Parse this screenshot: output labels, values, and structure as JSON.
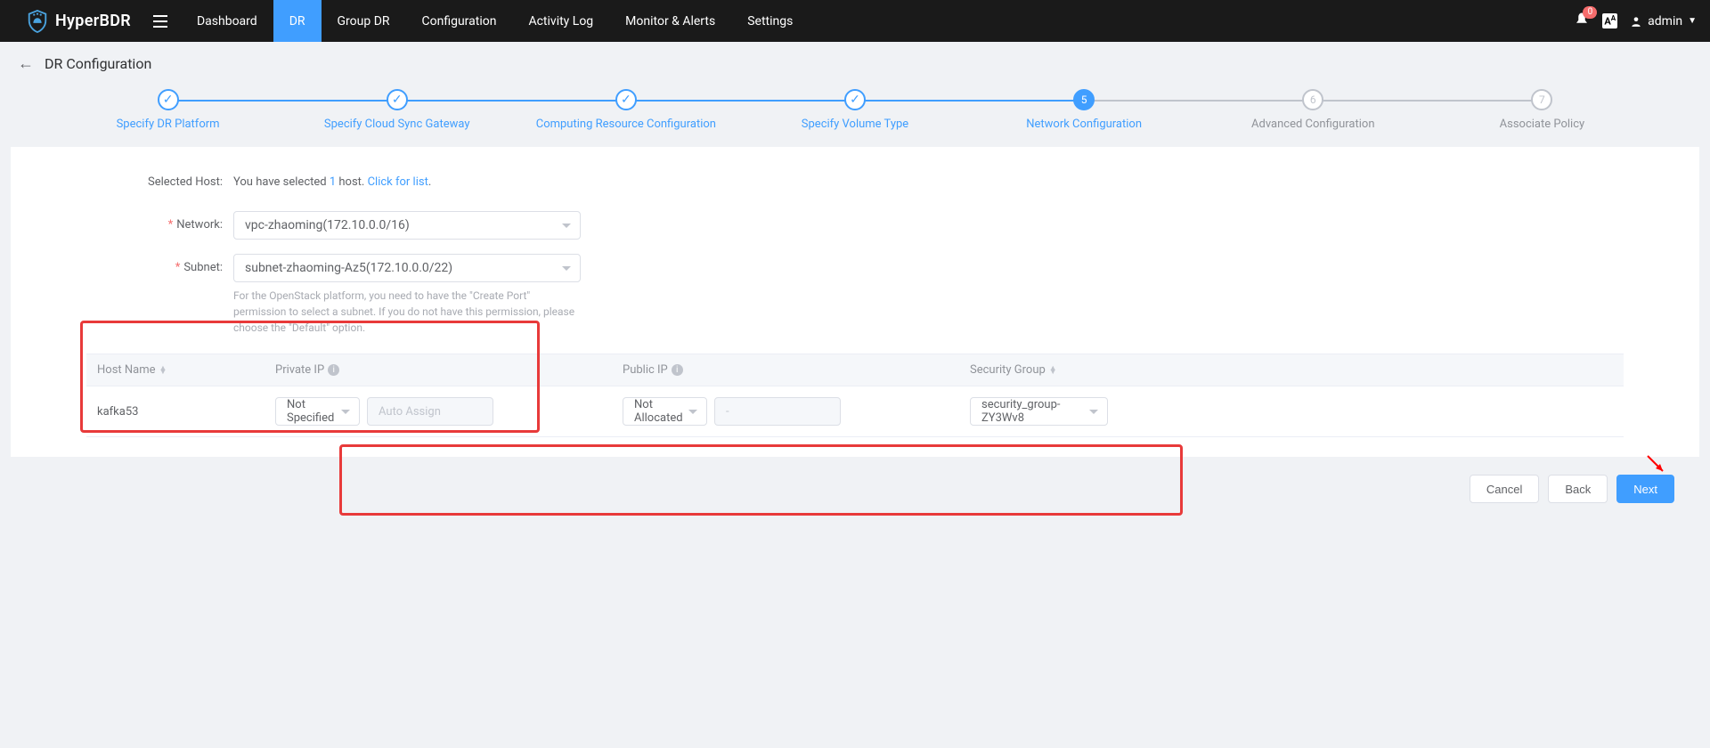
{
  "brand": "HyperBDR",
  "nav": [
    "Dashboard",
    "DR",
    "Group DR",
    "Configuration",
    "Activity Log",
    "Monitor & Alerts",
    "Settings"
  ],
  "active_nav_index": 1,
  "alert_count": "0",
  "lang_indicator": "A",
  "user": "admin",
  "page_title": "DR Configuration",
  "steps": [
    "Specify DR Platform",
    "Specify Cloud Sync Gateway",
    "Computing Resource Configuration",
    "Specify Volume Type",
    "Network Configuration",
    "Advanced Configuration",
    "Associate Policy"
  ],
  "current_step": 5,
  "selected_host": {
    "label": "Selected Host:",
    "prefix": "You have selected ",
    "count": "1",
    "middle": " host. ",
    "link": "Click for list",
    "suffix": "."
  },
  "form": {
    "network_label": "Network:",
    "network_value": "vpc-zhaoming(172.10.0.0/16)",
    "subnet_label": "Subnet:",
    "subnet_value": "subnet-zhaoming-Az5(172.10.0.0/22)",
    "subnet_hint": "For the OpenStack platform, you need to have the \"Create Port\" permission to select a subnet. If you do not have this permission, please choose the \"Default\" option."
  },
  "table": {
    "headers": {
      "host": "Host Name",
      "private_ip": "Private IP",
      "public_ip": "Public IP",
      "security_group": "Security Group"
    },
    "row": {
      "host": "kafka53",
      "private_ip_mode": "Not Specified",
      "private_ip_placeholder": "Auto Assign",
      "public_ip_mode": "Not Allocated",
      "public_ip_value": "-",
      "security_group": "security_group-ZY3Wv8"
    }
  },
  "buttons": {
    "cancel": "Cancel",
    "back": "Back",
    "next": "Next"
  }
}
